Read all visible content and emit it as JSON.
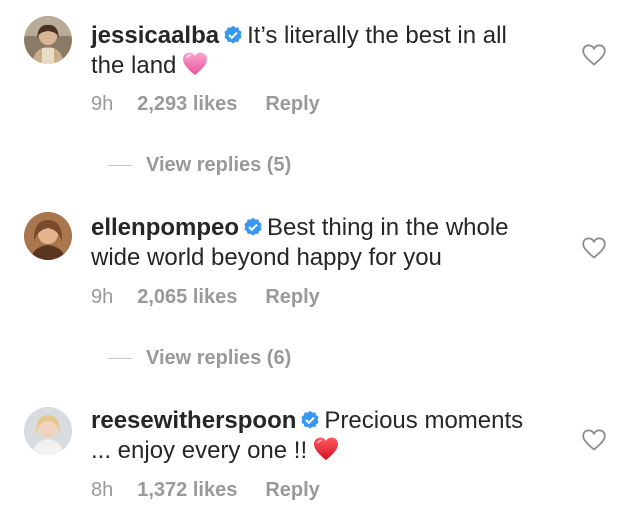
{
  "comments": [
    {
      "username": "jessicaalba",
      "text": "It’s literally the best in all the land",
      "emoji": "pink-heart-emoji",
      "time": "9h",
      "likes": "2,293 likes",
      "reply_label": "Reply",
      "view_replies": "View replies (5)"
    },
    {
      "username": "ellenpompeo",
      "text": "Best thing in the whole wide world beyond happy for you",
      "time": "9h",
      "likes": "2,065 likes",
      "reply_label": "Reply",
      "view_replies": "View replies (6)"
    },
    {
      "username": "reesewitherspoon",
      "text": "Precious moments ... enjoy every one !!",
      "emoji": "red-heart-emoji",
      "time": "8h",
      "likes": "1,372 likes",
      "reply_label": "Reply"
    }
  ],
  "icons": {
    "verified": "verified-badge-icon",
    "like": "heart-outline-icon"
  },
  "colors": {
    "text": "#262626",
    "secondary": "#999999",
    "verified": "#3897f0",
    "pink_heart": "#f06ea9",
    "red_heart": "#e0142c"
  }
}
